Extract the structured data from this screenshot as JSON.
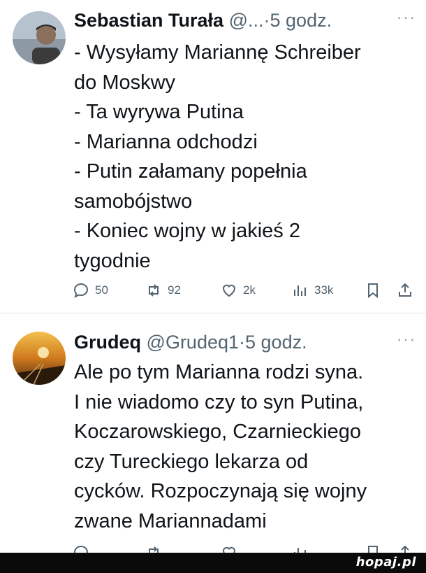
{
  "tweets": [
    {
      "author": "Sebastian Turała",
      "handle": "@...",
      "sep": "·",
      "time": "5 godz.",
      "more": "···",
      "lines": [
        "- Wysyłamy Mariannę Schreiber",
        "do Moskwy",
        "- Ta wyrywa Putina",
        "- Marianna odchodzi",
        "- Putin załamany popełnia",
        "samobójstwo",
        "- Koniec wojny w jakieś 2",
        "tygodnie"
      ],
      "replies": "50",
      "retweets": "92",
      "likes": "2k",
      "views": "33k"
    },
    {
      "author": "Grudeq",
      "handle": "@Grudeq1",
      "sep": "·",
      "time": "5 godz.",
      "more": "···",
      "lines": [
        "Ale po tym Marianna rodzi syna.",
        "I nie wiadomo czy to syn Putina,",
        "Koczarowskiego, Czarnieckiego",
        "czy Tureckiego lekarza od",
        "cycków. Rozpoczynają się wojny",
        "zwane Mariannadami"
      ]
    }
  ],
  "icons": {
    "reply": "reply-icon",
    "retweet": "retweet-icon",
    "like": "heart-icon",
    "views": "views-icon",
    "bookmark": "bookmark-icon",
    "share": "share-icon"
  },
  "watermark": "hopaj.pl",
  "colors": {
    "text": "#0f1419",
    "muted": "#536471",
    "bar": "#0a0a0a"
  }
}
